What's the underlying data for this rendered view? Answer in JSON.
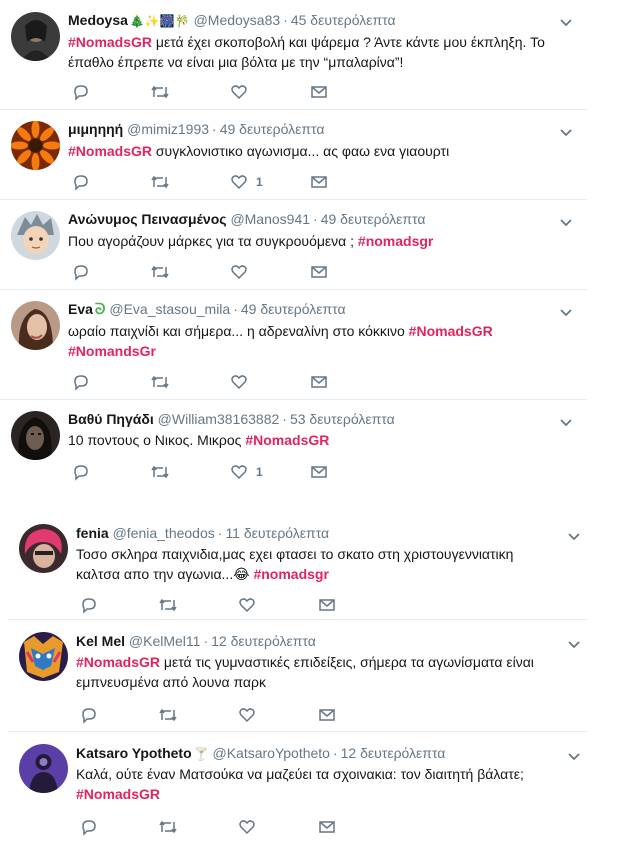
{
  "hashtags": {
    "upper": "#NomadsGR",
    "lower": "#nomadsgr",
    "typo": "#NomandsGr"
  },
  "tweets": [
    {
      "name": "Medoysa",
      "emoji": "🎄✨🎆🎋",
      "handle": "@Medoysa83",
      "time": "45 δευτερόλεπτα",
      "pre": "",
      "tag": "#NomadsGR",
      "post": " μετά έχει σκοποβολή και ψάρεμα ? Άντε κάντε μου έκπληξη. Το έπαθλο έπρεπε να είναι μια βόλτα με την “μπαλαρίνα”!",
      "likes": ""
    },
    {
      "name": "μιμηηηή",
      "emoji": "",
      "handle": "@mimiz1993",
      "time": "49 δευτερόλεπτα",
      "pre": "",
      "tag": "#NomadsGR",
      "post": " συγκλονιστικο αγωνισμα... ας φαω ενα γιαουρτι",
      "likes": "1"
    },
    {
      "name": "Ανώνυμος Πεινασμένος",
      "emoji": "",
      "handle": "@Manos941",
      "time": "49 δευτερόλεπτα",
      "pre": "Που αγοράζουν μάρκες για τα συγκρουόμενα ; ",
      "tag": "#nomadsgr",
      "post": "",
      "likes": ""
    },
    {
      "name": "Eva",
      "emoji": "ᘐ",
      "handle": "@Eva_stasou_mila",
      "time": "49 δευτερόλεπτα",
      "pre": "ωραίο παιχνίδι και σήμερα... η αδρεναλίνη στο κόκκινο ",
      "tag": "#NomadsGR",
      "post": "",
      "tag2": "#NomandsGr",
      "likes": ""
    },
    {
      "name": "Βαθύ Πηγάδι",
      "emoji": "",
      "handle": "@William38163882",
      "time": "53 δευτερόλεπτα",
      "pre": "10 ποντους ο Νικος. Μικρος ",
      "tag": "#NomadsGR",
      "post": "",
      "likes": "1"
    },
    {
      "name": "fenia",
      "emoji": "",
      "handle": "@fenia_theodos",
      "time": "11 δευτερόλεπτα",
      "pre": "Τοσο σκληρα παιχνιδια,μας εχει φτασει το σκατο στη χριστουγεννιατικη καλτσα απο την αγωνια...😂 ",
      "tag": "#nomadsgr",
      "post": "",
      "likes": ""
    },
    {
      "name": "Kel Mel",
      "emoji": "",
      "handle": "@KelMel11",
      "time": "12 δευτερόλεπτα",
      "pre": "",
      "tag": "#NomadsGR",
      "post": " μετά τις γυμναστικές επιδείξεις, σήμερα τα αγωνίσματα είναι εμπνευσμένα από λουνα παρκ",
      "likes": ""
    },
    {
      "name": "Katsaro Ypotheto",
      "emoji": "🍸",
      "handle": "@KatsaroYpotheto",
      "time": "12 δευτερόλεπτα",
      "pre": "Καλά, ούτε έναν Ματσούκα να μαζεύει τα σχοινακια: τον διαιτητή βάλατε;",
      "tag": "",
      "post": "",
      "tag2": "#NomadsGR",
      "likes": ""
    }
  ],
  "colors": {
    "hashtag": "#e0245e",
    "name": "#14171a",
    "meta": "#657786",
    "divider": "#e6ecf0"
  },
  "icons": {
    "reply": "reply-icon",
    "retweet": "retweet-icon",
    "like": "heart-icon",
    "dm": "envelope-icon",
    "menu": "chevron-down-icon"
  }
}
